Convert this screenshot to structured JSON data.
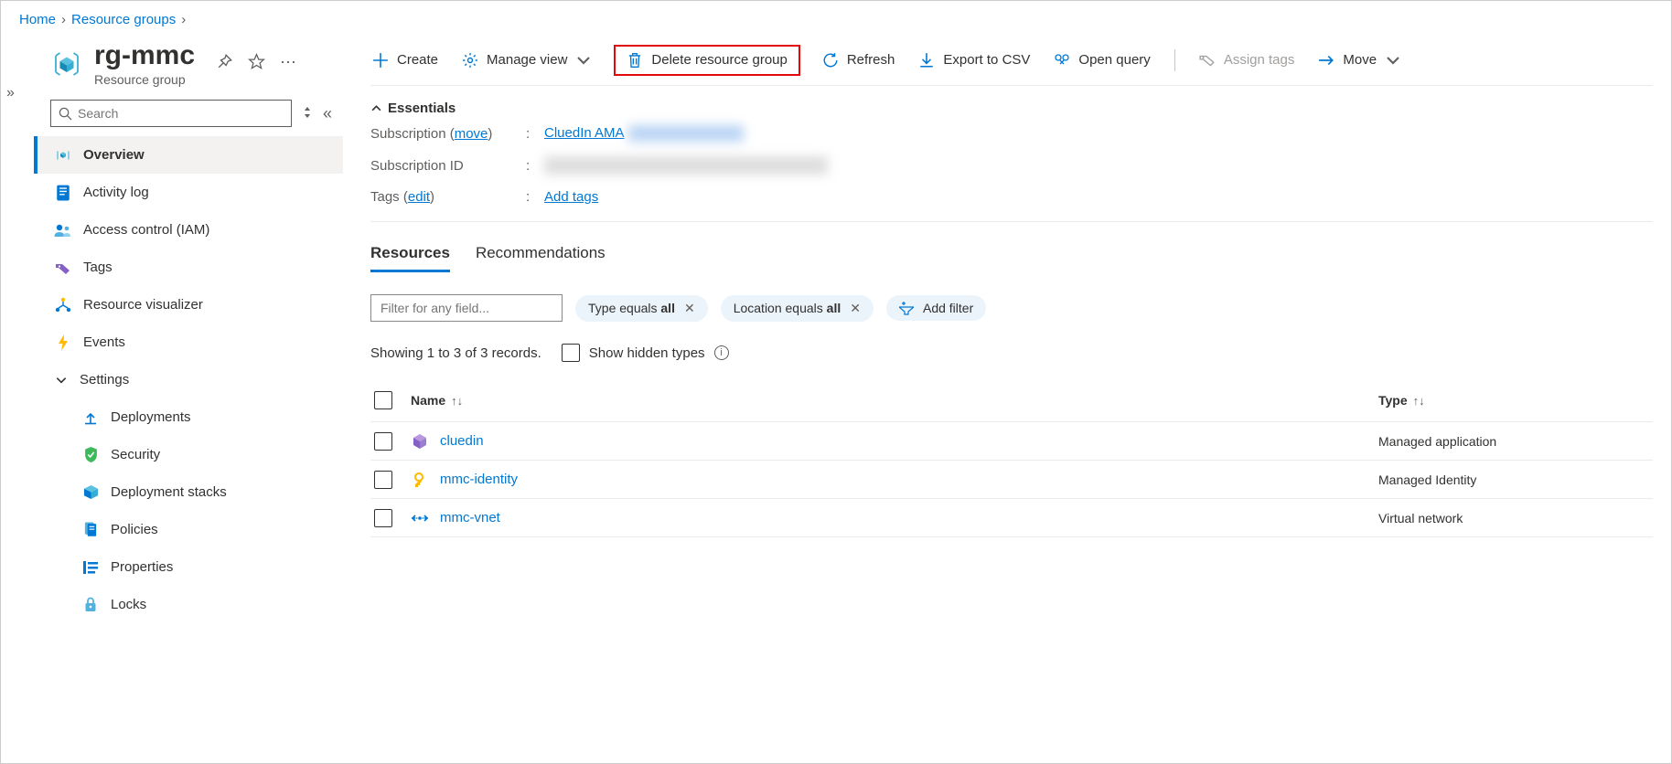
{
  "breadcrumb": {
    "home": "Home",
    "rg": "Resource groups"
  },
  "header": {
    "title": "rg-mmc",
    "subtitle": "Resource group"
  },
  "search": {
    "placeholder": "Search"
  },
  "nav": {
    "overview": "Overview",
    "activity": "Activity log",
    "access": "Access control (IAM)",
    "tags": "Tags",
    "visualizer": "Resource visualizer",
    "events": "Events",
    "settings": "Settings",
    "deployments": "Deployments",
    "security": "Security",
    "stacks": "Deployment stacks",
    "policies": "Policies",
    "properties": "Properties",
    "locks": "Locks"
  },
  "toolbar": {
    "create": "Create",
    "manage_view": "Manage view",
    "delete_rg": "Delete resource group",
    "refresh": "Refresh",
    "export_csv": "Export to CSV",
    "open_query": "Open query",
    "assign_tags": "Assign tags",
    "move": "Move"
  },
  "essentials": {
    "title": "Essentials",
    "sub_label_prefix": "Subscription (",
    "sub_label_move": "move",
    "sub_label_suffix": ")",
    "sub_value": "CluedIn AMA",
    "subid_label": "Subscription ID",
    "tags_label_prefix": "Tags (",
    "tags_label_edit": "edit",
    "tags_label_suffix": ")",
    "tags_value": "Add tags"
  },
  "tabs": {
    "resources": "Resources",
    "recommendations": "Recommendations"
  },
  "filters": {
    "placeholder": "Filter for any field...",
    "pill1_prefix": "Type equals ",
    "pill1_val": "all",
    "pill2_prefix": "Location equals ",
    "pill2_val": "all",
    "add": "Add filter"
  },
  "status": {
    "records": "Showing 1 to 3 of 3 records.",
    "hidden": "Show hidden types"
  },
  "table": {
    "col_name": "Name",
    "col_type": "Type",
    "rows": [
      {
        "name": "cluedin",
        "type": "Managed application",
        "icon": "app"
      },
      {
        "name": "mmc-identity",
        "type": "Managed Identity",
        "icon": "identity"
      },
      {
        "name": "mmc-vnet",
        "type": "Virtual network",
        "icon": "vnet"
      }
    ]
  }
}
